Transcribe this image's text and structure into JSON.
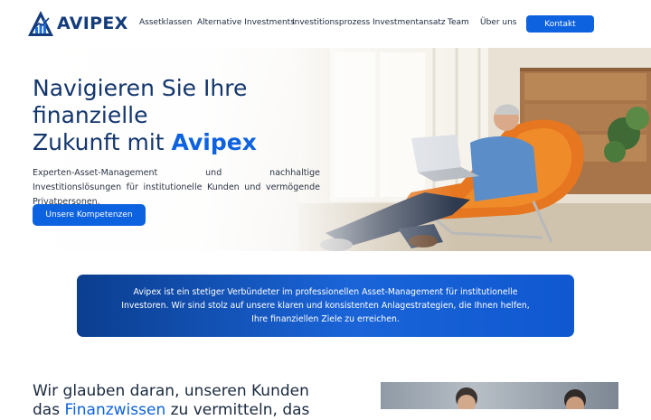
{
  "brand": {
    "name": "AVIPEX",
    "color": "#143c7c",
    "accent": "#0d62e0"
  },
  "nav": {
    "items": [
      {
        "label": "Assetklassen"
      },
      {
        "label": "Alternative Investments"
      },
      {
        "label": "Investitionsprozess"
      },
      {
        "label": "Investmentansatz"
      },
      {
        "label": "Team"
      },
      {
        "label": "Über uns"
      }
    ],
    "cta": "Kontakt"
  },
  "hero": {
    "title_line1": "Navigieren Sie Ihre",
    "title_line2": "finanzielle",
    "title_line3_prefix": "Zukunft mit ",
    "title_line3_accent": "Avipex",
    "description": "Experten-Asset-Management und nachhaltige Investitionslösungen für institutionelle Kunden und vermögende Privatpersonen.",
    "button": "Unsere Kompetenzen",
    "image_icon": "man-with-laptop-photo"
  },
  "banner": {
    "text": "Avipex ist ein stetiger Verbündeter im professionellen Asset-Management für institutionelle Investoren. Wir sind stolz auf unsere klaren und konsistenten Anlagestrategien, die Ihnen helfen, Ihre finanziellen Ziele zu erreichen."
  },
  "section": {
    "title_line1": "Wir glauben daran, unseren Kunden",
    "title_line2_prefix": "das ",
    "title_line2_highlight": "Finanzwissen",
    "title_line2_suffix": " zu vermitteln, das",
    "image_icon": "team-photo"
  }
}
